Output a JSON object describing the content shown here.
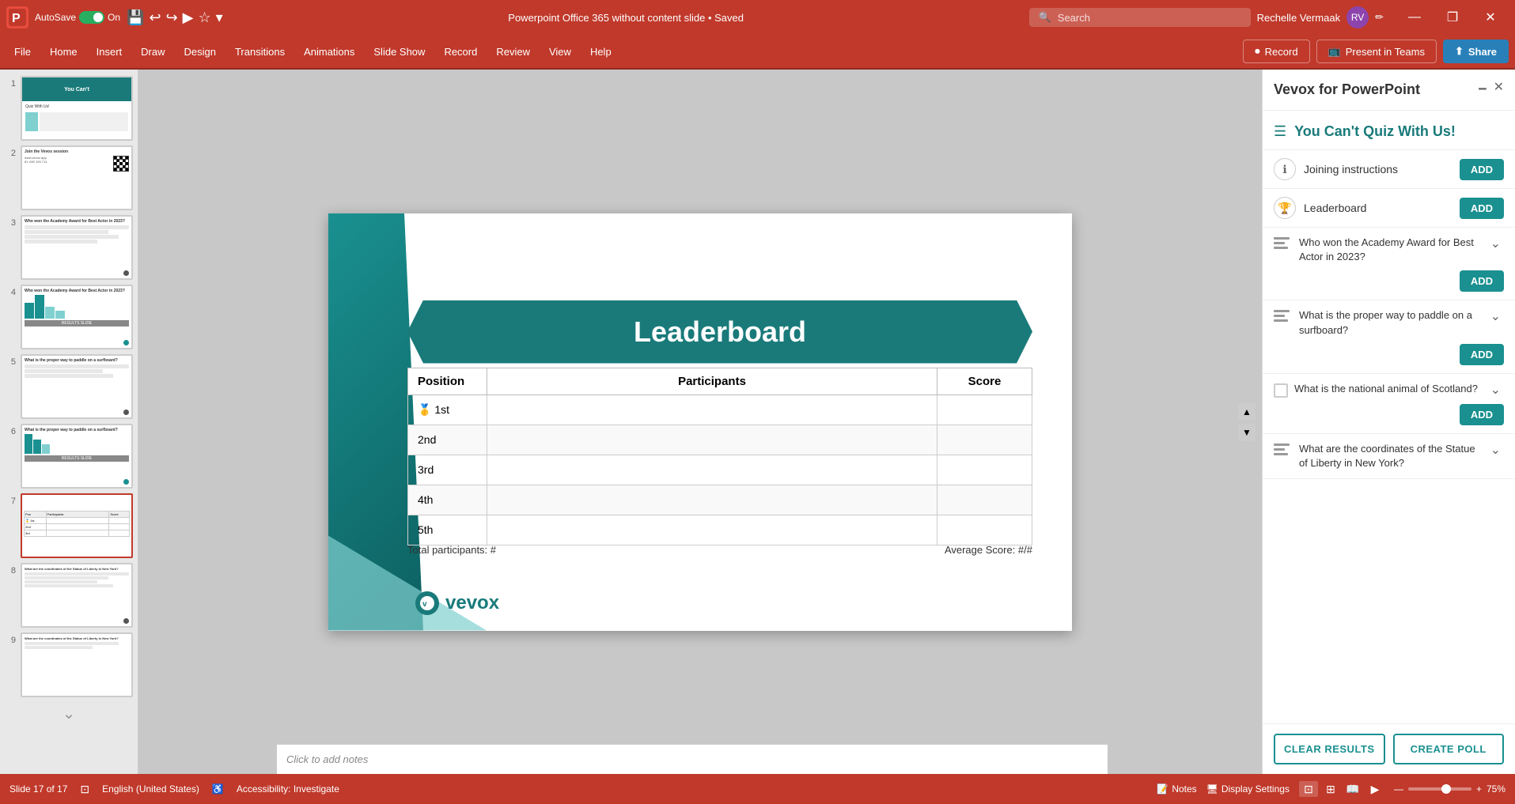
{
  "titlebar": {
    "app_icon": "P",
    "autosave_label": "AutoSave",
    "toggle_state": "On",
    "title": "Powerpoint Office 365 without content slide • Saved",
    "search_placeholder": "Search",
    "user_name": "Rechelle Vermaak",
    "minimize": "—",
    "restore": "❐",
    "close": "✕"
  },
  "ribbon": {
    "tabs": [
      "File",
      "Home",
      "Insert",
      "Draw",
      "Design",
      "Transitions",
      "Animations",
      "Slide Show",
      "Record",
      "Review",
      "View",
      "Help"
    ],
    "record_label": "Record",
    "present_label": "Present in Teams",
    "share_label": "Share"
  },
  "slide_panel": {
    "slides": [
      {
        "num": 1,
        "type": "intro"
      },
      {
        "num": 2,
        "type": "qr"
      },
      {
        "num": 3,
        "type": "question"
      },
      {
        "num": 4,
        "type": "results"
      },
      {
        "num": 5,
        "type": "question2"
      },
      {
        "num": 6,
        "type": "results2"
      },
      {
        "num": 7,
        "type": "leaderboard",
        "active": true
      },
      {
        "num": 8,
        "type": "question3"
      },
      {
        "num": 9,
        "type": "question4"
      }
    ]
  },
  "slide": {
    "leaderboard_title": "Leaderboard",
    "position_header": "Position",
    "participants_header": "Participants",
    "score_header": "Score",
    "rows": [
      {
        "position": "🥇 1st",
        "participant": "",
        "score": ""
      },
      {
        "position": "2nd",
        "participant": "",
        "score": ""
      },
      {
        "position": "3rd",
        "participant": "",
        "score": ""
      },
      {
        "position": "4th",
        "participant": "",
        "score": ""
      },
      {
        "position": "5th",
        "participant": "",
        "score": ""
      }
    ],
    "total_participants": "Total participants: #",
    "average_score": "Average Score: #/#",
    "vevox_logo": "vevox",
    "notes_placeholder": "Click to add notes"
  },
  "vevox_panel": {
    "title": "Vevox for PowerPoint",
    "quiz_title": "You Can't Quiz With Us!",
    "sections": [
      {
        "id": "joining",
        "icon": "ℹ",
        "icon_type": "circle",
        "label": "Joining instructions",
        "has_add": true
      },
      {
        "id": "leaderboard",
        "icon": "🏆",
        "icon_type": "circle",
        "label": "Leaderboard",
        "has_add": true
      }
    ],
    "questions": [
      {
        "id": "q1",
        "text": "Who won the Academy Award for Best Actor in 2023?",
        "has_add": true,
        "type": "lines"
      },
      {
        "id": "q2",
        "text": "What is the proper way to paddle on a surfboard?",
        "has_add": true,
        "type": "lines"
      },
      {
        "id": "q3",
        "text": "What is the national animal of Scotland?",
        "has_add": true,
        "type": "checkbox"
      },
      {
        "id": "q4",
        "text": "What are the coordinates of the Statue of Liberty in New York?",
        "has_add": false,
        "type": "lines"
      }
    ],
    "clear_results_label": "CLEAR RESULTS",
    "create_poll_label": "CREATE POLL"
  },
  "status_bar": {
    "slide_info": "Slide 17 of 17",
    "language": "English (United States)",
    "accessibility": "Accessibility: Investigate",
    "notes_label": "Notes",
    "display_label": "Display Settings",
    "zoom_level": "75%"
  }
}
